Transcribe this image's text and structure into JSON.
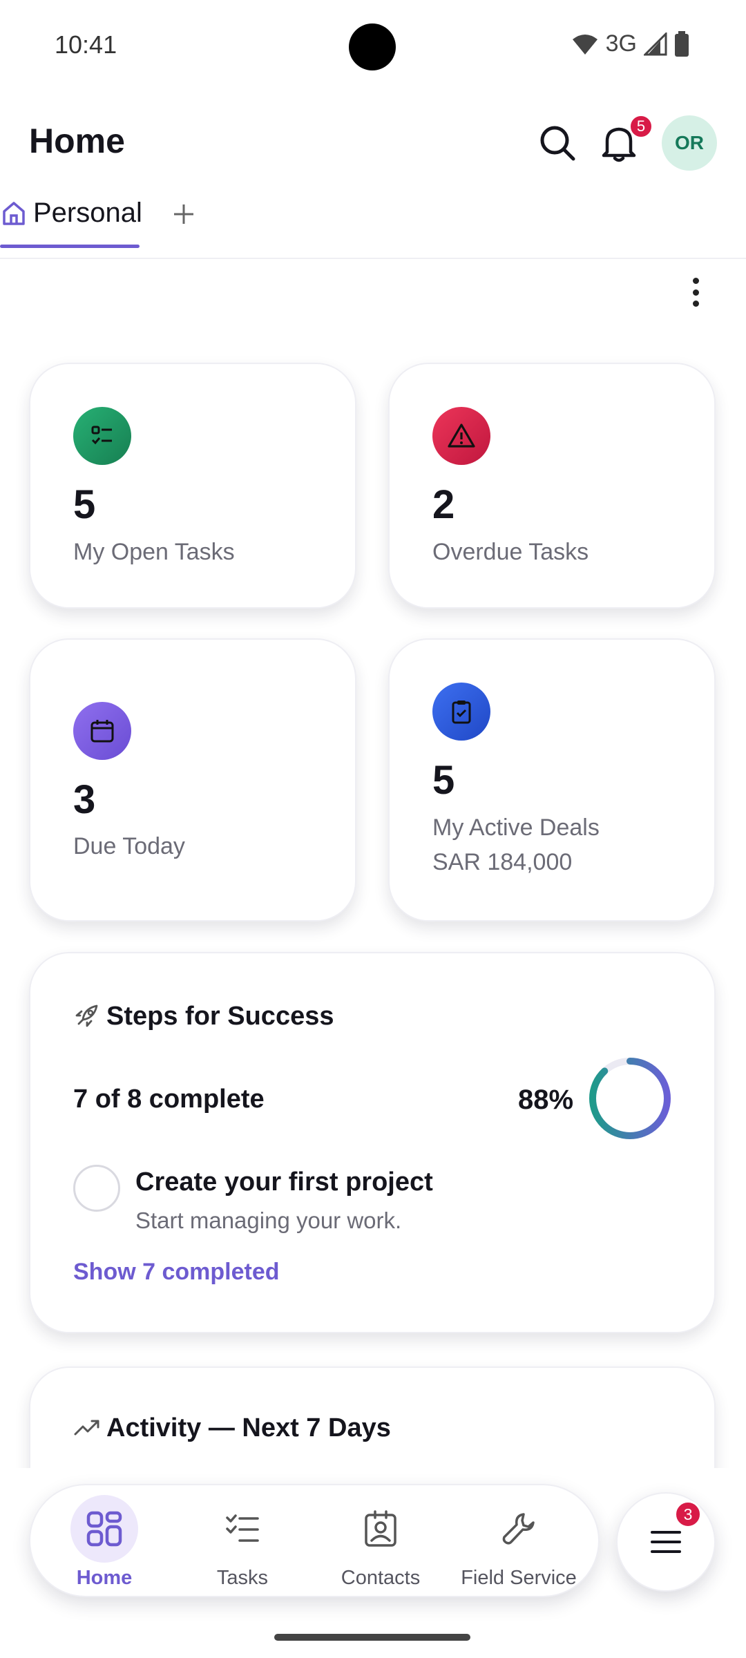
{
  "status_bar": {
    "time": "10:41",
    "network": "3G"
  },
  "header": {
    "title": "Home",
    "notifications_badge": "5",
    "avatar_initials": "OR"
  },
  "tabs": [
    {
      "label": "Personal"
    }
  ],
  "stats": [
    {
      "value": "5",
      "label": "My Open Tasks",
      "color": "#1f9a63"
    },
    {
      "value": "2",
      "label": "Overdue Tasks",
      "color": "#d81b47"
    },
    {
      "value": "3",
      "label": "Due Today",
      "color": "#7b5ce0"
    },
    {
      "value": "5",
      "label": "My Active Deals",
      "sub": "SAR 184,000",
      "color": "#2f5fe0"
    }
  ],
  "steps": {
    "title": "Steps for Success",
    "count_text": "7 of 8 complete",
    "percent_text": "88%",
    "progress": 0.88,
    "pending_item": {
      "title": "Create your first project",
      "subtitle": "Start managing your work."
    },
    "show_completed": "Show 7 completed"
  },
  "activity": {
    "title": "Activity — Next 7 Days"
  },
  "bottom_nav": [
    {
      "label": "Home",
      "icon": "grid-icon",
      "active": true
    },
    {
      "label": "Tasks",
      "icon": "checklist-icon"
    },
    {
      "label": "Contacts",
      "icon": "contact-badge-icon"
    },
    {
      "label": "Field Service",
      "icon": "wrench-icon"
    }
  ],
  "menu_badge": "3"
}
